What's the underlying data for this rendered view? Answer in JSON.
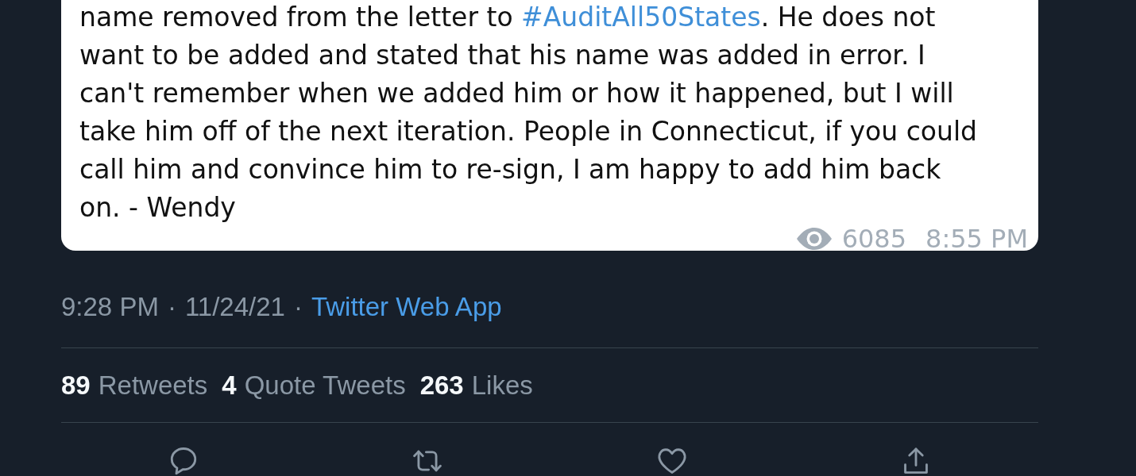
{
  "message_card": {
    "text_before": "name removed from the letter to ",
    "hashtag": "#AuditAll50States",
    "text_after": ". He does not\nwant to be added and stated that his name was added in error. I\ncan't remember when we added him or how it happened, but I will\ntake him off of the next iteration. People in Connecticut, if you could\ncall him and convince him to re-sign, I am happy to add him back\non. - Wendy",
    "views": "6085",
    "time": "8:55 PM"
  },
  "tweet_meta": {
    "time": "9:28 PM",
    "separator_1": "·",
    "date": "11/24/21",
    "separator_2": "·",
    "source": "Twitter Web App"
  },
  "stats": [
    {
      "count": "89",
      "label": "Retweets"
    },
    {
      "count": "4",
      "label": "Quote Tweets"
    },
    {
      "count": "263",
      "label": "Likes"
    }
  ],
  "actions": [
    {
      "kind": "reply"
    },
    {
      "kind": "retweet"
    },
    {
      "kind": "like"
    },
    {
      "kind": "share"
    }
  ]
}
